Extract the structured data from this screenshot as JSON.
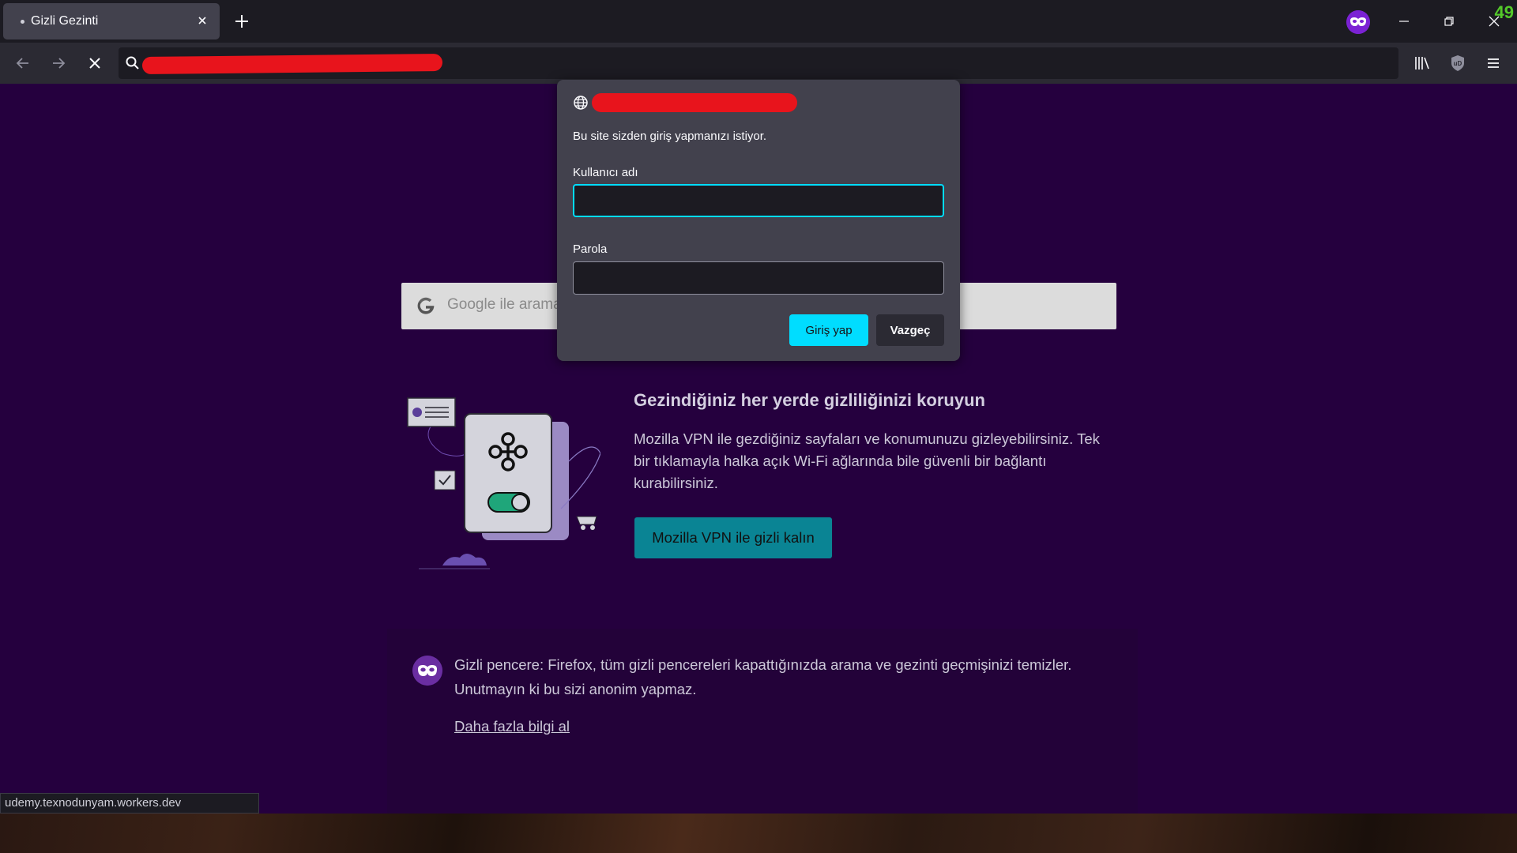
{
  "tab": {
    "title": "Gizli Gezinti"
  },
  "window": {
    "counter": "49"
  },
  "dialog": {
    "message": "Bu site sizden giriş yapmanızı istiyor.",
    "username_label": "Kullanıcı adı",
    "username_value": "",
    "password_label": "Parola",
    "password_value": "",
    "login_button": "Giriş yap",
    "cancel_button": "Vazgeç"
  },
  "search": {
    "placeholder": "Google ile arama"
  },
  "promo": {
    "title": "Gezindiğiniz her yerde gizliliğinizi koruyun",
    "text": "Mozilla VPN ile gezdiğiniz sayfaları ve konumunuzu gizleyebilirsiniz. Tek bir tıklamayla halka açık Wi-Fi ağlarında bile güvenli bir bağlantı kurabilirsiniz.",
    "button": "Mozilla VPN ile gizli kalın"
  },
  "private_notice": {
    "text": "Gizli pencere: Firefox, tüm gizli pencereleri kapattığınızda arama ve gezinti geçmişinizi temizler. Unutmayın ki bu sizi anonim yapmaz.",
    "learn_more": "Daha fazla bilgi al"
  },
  "status_bar": {
    "url": "udemy.texnodunyam.workers.dev"
  },
  "colors": {
    "accent": "#00ddff",
    "page_background": "#25003e",
    "vpn_button": "#0a8494",
    "private_purple": "#7b22d4",
    "redaction": "#e8141c"
  },
  "icons": [
    "close-icon",
    "plus-icon",
    "private-mask-icon",
    "minimize-icon",
    "restore-icon",
    "back-icon",
    "forward-icon",
    "stop-icon",
    "search-icon",
    "library-icon",
    "ublock-icon",
    "menu-icon",
    "globe-icon",
    "google-icon"
  ]
}
